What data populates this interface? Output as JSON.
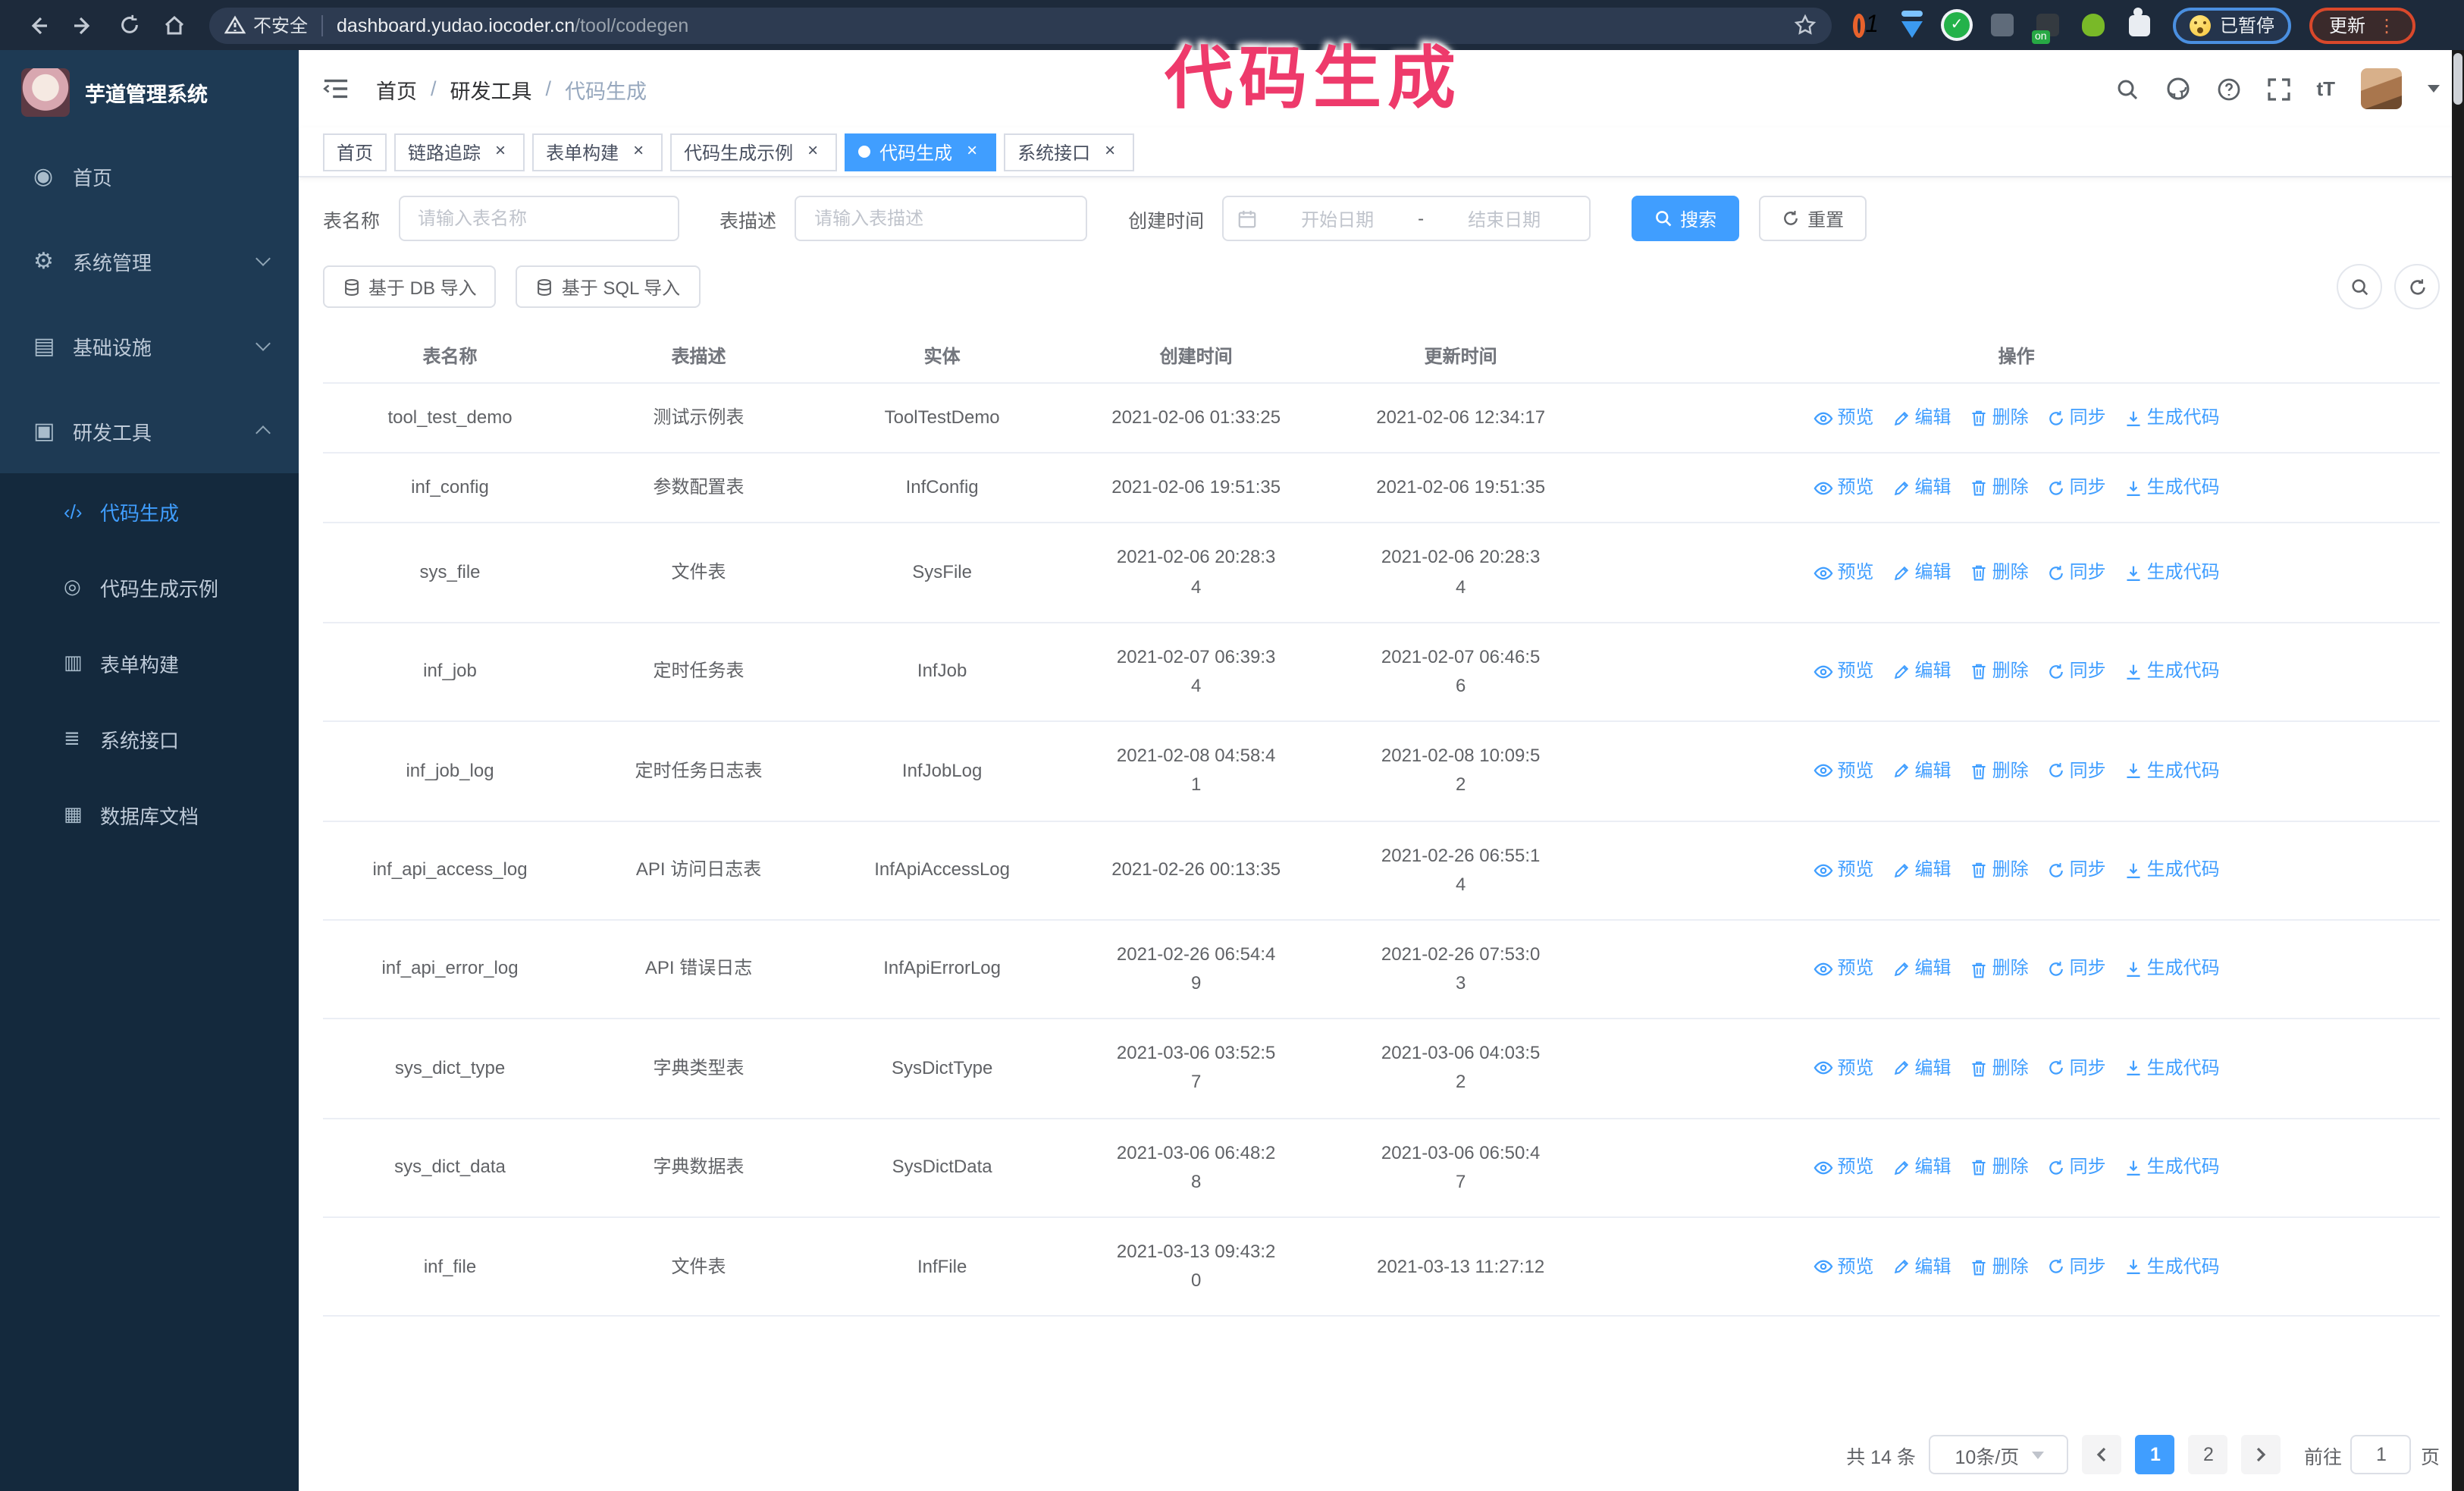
{
  "browser": {
    "security_label": "不安全",
    "url_domain": "dashboard.yudao.iocoder.cn",
    "url_path": "/tool/codegen",
    "paused_badge": "已暂停",
    "update_button": "更新"
  },
  "annotation": {
    "text": "代码生成",
    "color": "#ee3a6b"
  },
  "sidebar": {
    "app_title": "芋道管理系统",
    "items": [
      {
        "name": "home",
        "label": "首页",
        "icon": "dashboard-icon",
        "chevron": "none"
      },
      {
        "name": "system-mgmt",
        "label": "系统管理",
        "icon": "gear-icon",
        "chevron": "down"
      },
      {
        "name": "infrastructure",
        "label": "基础设施",
        "icon": "infra-icon",
        "chevron": "down"
      },
      {
        "name": "dev-tools",
        "label": "研发工具",
        "icon": "tools-icon",
        "chevron": "up"
      }
    ],
    "submenu": [
      {
        "name": "codegen",
        "label": "代码生成",
        "icon": "code-icon",
        "active": true
      },
      {
        "name": "codegen-example",
        "label": "代码生成示例",
        "icon": "example-icon",
        "active": false
      },
      {
        "name": "form-builder",
        "label": "表单构建",
        "icon": "form-icon",
        "active": false
      },
      {
        "name": "system-api",
        "label": "系统接口",
        "icon": "api-icon",
        "active": false
      },
      {
        "name": "db-doc",
        "label": "数据库文档",
        "icon": "dbdoc-icon",
        "active": false
      }
    ]
  },
  "header": {
    "breadcrumb": [
      "首页",
      "研发工具",
      "代码生成"
    ]
  },
  "tabs": [
    {
      "name": "home",
      "label": "首页",
      "closable": false,
      "active": false
    },
    {
      "name": "tracer",
      "label": "链路追踪",
      "closable": true,
      "active": false
    },
    {
      "name": "form-builder",
      "label": "表单构建",
      "closable": true,
      "active": false
    },
    {
      "name": "codegen-example",
      "label": "代码生成示例",
      "closable": true,
      "active": false
    },
    {
      "name": "codegen",
      "label": "代码生成",
      "closable": true,
      "active": true
    },
    {
      "name": "system-api",
      "label": "系统接口",
      "closable": true,
      "active": false
    }
  ],
  "filters": {
    "table_name_label": "表名称",
    "table_name_placeholder": "请输入表名称",
    "table_desc_label": "表描述",
    "table_desc_placeholder": "请输入表描述",
    "create_time_label": "创建时间",
    "date_start_placeholder": "开始日期",
    "date_separator": "-",
    "date_end_placeholder": "结束日期",
    "search_button": "搜索",
    "reset_button": "重置"
  },
  "toolbar": {
    "import_db_button": "基于 DB 导入",
    "import_sql_button": "基于 SQL 导入"
  },
  "table": {
    "columns": [
      "表名称",
      "表描述",
      "实体",
      "创建时间",
      "更新时间",
      "操作"
    ],
    "row_actions": [
      "预览",
      "编辑",
      "删除",
      "同步",
      "生成代码"
    ],
    "rows": [
      {
        "name": "tool_test_demo",
        "desc": "测试示例表",
        "entity": "ToolTestDemo",
        "created": "2021-02-06 01:33:25",
        "updated": "2021-02-06 12:34:17"
      },
      {
        "name": "inf_config",
        "desc": "参数配置表",
        "entity": "InfConfig",
        "created": "2021-02-06 19:51:35",
        "updated": "2021-02-06 19:51:35"
      },
      {
        "name": "sys_file",
        "desc": "文件表",
        "entity": "SysFile",
        "created": "2021-02-06 20:28:3\n4",
        "updated": "2021-02-06 20:28:3\n4"
      },
      {
        "name": "inf_job",
        "desc": "定时任务表",
        "entity": "InfJob",
        "created": "2021-02-07 06:39:3\n4",
        "updated": "2021-02-07 06:46:5\n6"
      },
      {
        "name": "inf_job_log",
        "desc": "定时任务日志表",
        "entity": "InfJobLog",
        "created": "2021-02-08 04:58:4\n1",
        "updated": "2021-02-08 10:09:5\n2"
      },
      {
        "name": "inf_api_access_log",
        "desc": "API 访问日志表",
        "entity": "InfApiAccessLog",
        "created": "2021-02-26 00:13:35",
        "updated": "2021-02-26 06:55:1\n4"
      },
      {
        "name": "inf_api_error_log",
        "desc": "API 错误日志",
        "entity": "InfApiErrorLog",
        "created": "2021-02-26 06:54:4\n9",
        "updated": "2021-02-26 07:53:0\n3"
      },
      {
        "name": "sys_dict_type",
        "desc": "字典类型表",
        "entity": "SysDictType",
        "created": "2021-03-06 03:52:5\n7",
        "updated": "2021-03-06 04:03:5\n2"
      },
      {
        "name": "sys_dict_data",
        "desc": "字典数据表",
        "entity": "SysDictData",
        "created": "2021-03-06 06:48:2\n8",
        "updated": "2021-03-06 06:50:4\n7"
      },
      {
        "name": "inf_file",
        "desc": "文件表",
        "entity": "InfFile",
        "created": "2021-03-13 09:43:2\n0",
        "updated": "2021-03-13 11:27:12"
      }
    ]
  },
  "pagination": {
    "total": "共 14 条",
    "page_size": "10条/页",
    "pages": [
      "1",
      "2"
    ],
    "active_page": "1",
    "goto_label": "前往",
    "goto_value": "1",
    "goto_suffix": "页"
  }
}
